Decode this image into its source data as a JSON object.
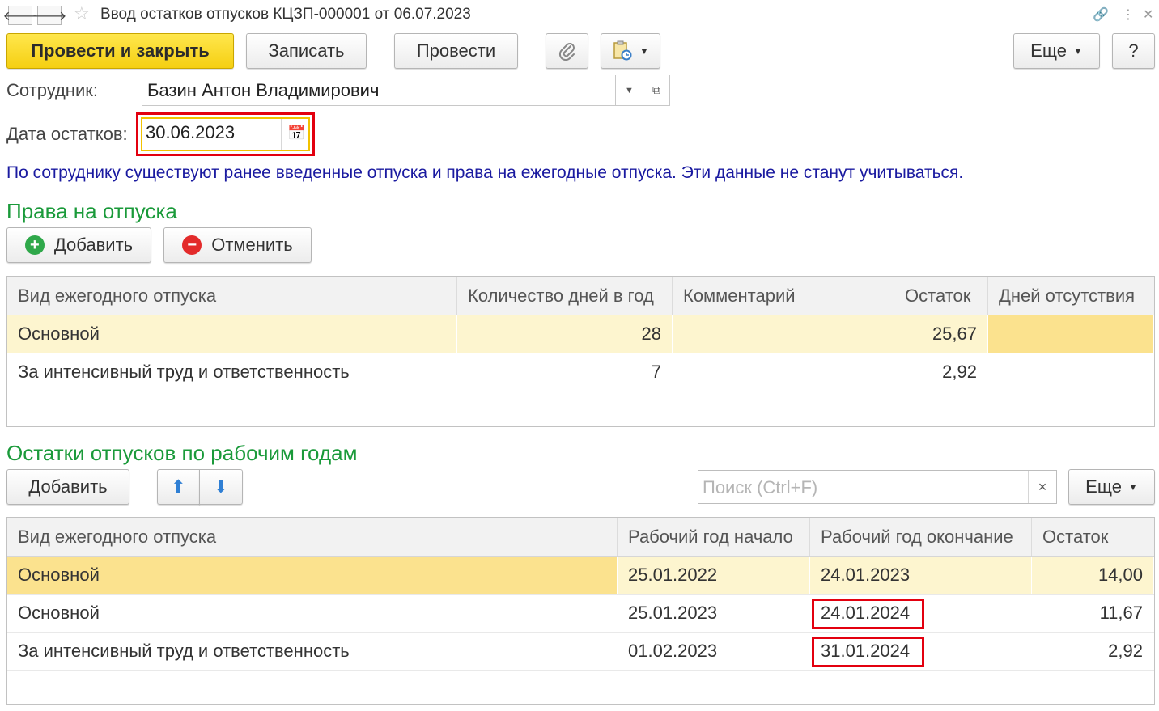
{
  "window": {
    "title": "Ввод остатков отпусков КЦЗП-000001 от 06.07.2023",
    "back_icon": "arrow-left-icon",
    "forward_icon": "arrow-right-icon",
    "favorite_icon": "star-icon",
    "link_icon": "link-icon",
    "menu_icon": "kebab-menu-icon",
    "close_icon": "close-icon"
  },
  "toolbar": {
    "post_close": "Провести и закрыть",
    "save": "Записать",
    "post": "Провести",
    "attach_icon": "paperclip-icon",
    "report_icon": "document-report-icon",
    "more": "Еще",
    "help": "?"
  },
  "form": {
    "employee_label": "Сотрудник:",
    "employee_value": "Базин Антон Владимирович",
    "date_label": "Дата остатков:",
    "date_value": "30.06.2023"
  },
  "info_message": "По сотруднику существуют ранее введенные отпуска и права на ежегодные отпуска. Эти данные не станут учитываться.",
  "rights": {
    "title": "Права на отпуска",
    "add": "Добавить",
    "cancel": "Отменить",
    "columns": [
      "Вид ежегодного отпуска",
      "Количество дней в год",
      "Комментарий",
      "Остаток",
      "Дней отсутствия"
    ],
    "rows": [
      {
        "type": "Основной",
        "days": "28",
        "comment": "",
        "remaining": "25,67",
        "absent": ""
      },
      {
        "type": "За интенсивный труд и ответственность",
        "days": "7",
        "comment": "",
        "remaining": "2,92",
        "absent": ""
      }
    ]
  },
  "balances": {
    "title": "Остатки отпусков по рабочим годам",
    "add": "Добавить",
    "search_placeholder": "Поиск (Ctrl+F)",
    "clear": "×",
    "more": "Еще",
    "columns": [
      "Вид ежегодного отпуска",
      "Рабочий год начало",
      "Рабочий год окончание",
      "Остаток"
    ],
    "rows": [
      {
        "type": "Основной",
        "start": "25.01.2022",
        "end": "24.01.2023",
        "remaining": "14,00"
      },
      {
        "type": "Основной",
        "start": "25.01.2023",
        "end": "24.01.2024",
        "remaining": "11,67"
      },
      {
        "type": "За интенсивный труд и ответственность",
        "start": "01.02.2023",
        "end": "31.01.2024",
        "remaining": "2,92"
      }
    ]
  },
  "colors": {
    "accent_yellow": "#f5cf12",
    "section_green": "#1a9a3a",
    "info_blue": "#1a1aa0",
    "highlight_red": "#e3000f",
    "selected_row": "#fdf5cf"
  }
}
